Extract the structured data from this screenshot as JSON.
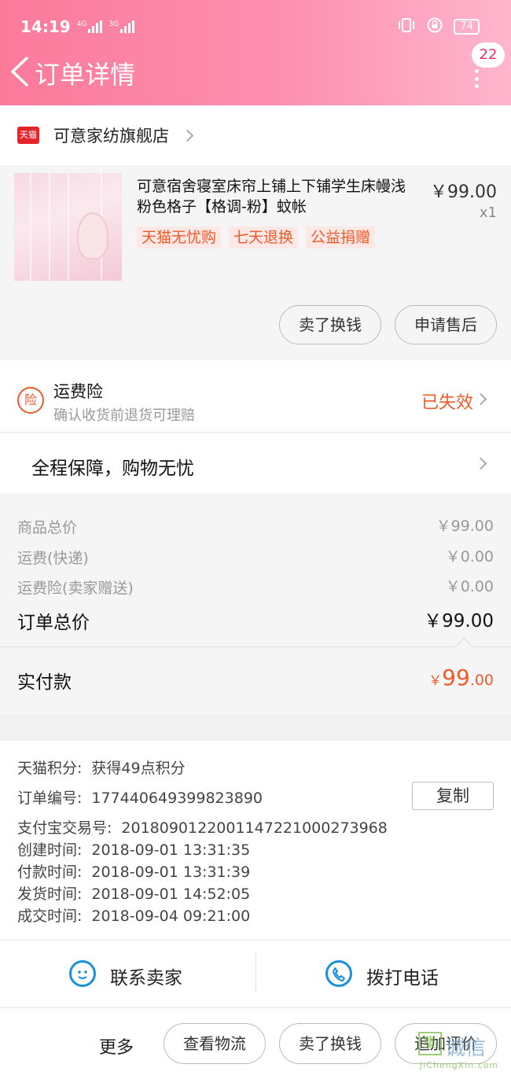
{
  "status_bar": {
    "time": "14:19",
    "signal_1": "4G",
    "signal_2": "3G",
    "battery": "74"
  },
  "header": {
    "title": "订单详情",
    "badge_count": "22"
  },
  "shop": {
    "logo_text": "天猫",
    "name": "可意家纺旗舰店"
  },
  "product": {
    "title": "可意宿舍寝室床帘上铺上下铺学生床幔浅粉色格子【格调-粉】蚊帐",
    "price": "￥99.00",
    "qty": "x1",
    "tags": [
      "天猫无忧购",
      "七天退换",
      "公益捐赠"
    ],
    "actions": [
      "卖了换钱",
      "申请售后"
    ]
  },
  "insurance": {
    "icon_text": "险",
    "title": "运费险",
    "subtitle": "确认收货前退货可理赔",
    "status": "已失效"
  },
  "guarantee": {
    "text": "全程保障，购物无忧"
  },
  "totals": {
    "rows": [
      {
        "label": "商品总价",
        "value": "￥99.00"
      },
      {
        "label": "运费(快递)",
        "value": "￥0.00"
      },
      {
        "label": "运费险(卖家赠送)",
        "value": "￥0.00"
      }
    ],
    "order_total_label": "订单总价",
    "order_total_value": "￥99.00"
  },
  "paid": {
    "label": "实付款",
    "currency": "￥",
    "integer": "99",
    "decimal": ".00"
  },
  "order_info": {
    "points_label": "天猫积分:",
    "points_value": "获得49点积分",
    "order_no_label": "订单编号:",
    "order_no_value": "177440649399823890",
    "copy_label": "复制",
    "alipay_label": "支付宝交易号:",
    "alipay_value": "2018090122001147221000273968",
    "created_label": "创建时间:",
    "created_value": "2018-09-01 13:31:35",
    "paid_label": "付款时间:",
    "paid_value": "2018-09-01 13:31:39",
    "shipped_label": "发货时间:",
    "shipped_value": "2018-09-01 14:52:05",
    "completed_label": "成交时间:",
    "completed_value": "2018-09-04 09:21:00"
  },
  "contact": {
    "seller_label": "联系卖家",
    "phone_label": "拨打电话"
  },
  "bottom": {
    "more_label": "更多",
    "buttons": [
      "查看物流",
      "卖了换钱",
      "追加评价"
    ]
  },
  "watermark": {
    "box": "集",
    "text": "诚信",
    "sub": "JiChengXin.com"
  },
  "colors": {
    "header_start": "#fb7a9a",
    "header_end": "#ffb6cd",
    "accent_orange": "#f05a28",
    "icon_blue": "#1a8fe0",
    "tmall_red": "#e4262b"
  }
}
